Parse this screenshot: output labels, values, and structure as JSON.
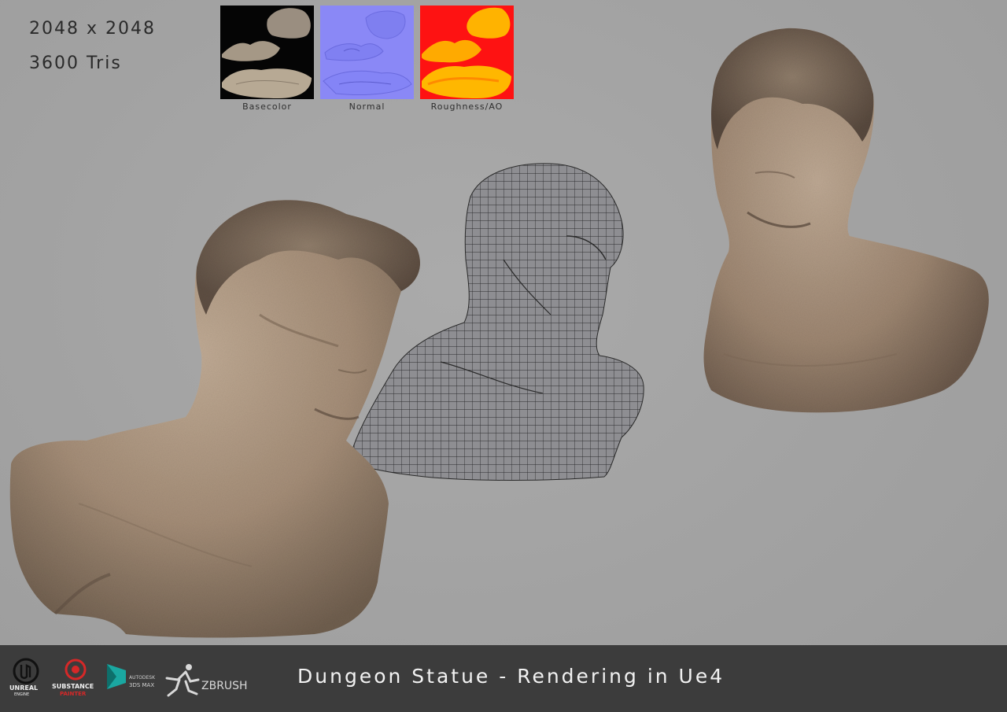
{
  "stats": {
    "resolution": "2048 x 2048",
    "tris": "3600 Tris"
  },
  "textures": [
    {
      "label": "Basecolor"
    },
    {
      "label": "Normal"
    },
    {
      "label": "Roughness/AO"
    }
  ],
  "footer": {
    "title": "Dungeon Statue - Rendering in Ue4",
    "logos": {
      "unreal_main": "UNREAL",
      "unreal_sub": "ENGINE",
      "substance_main": "SUBSTANCE",
      "substance_sub": "PAINTER",
      "max_main": "AUTODESK",
      "max_sub": "3DS MAX",
      "zbrush": "ZBRUSH"
    }
  },
  "colors": {
    "background": "#a3a3a3",
    "footer_bg": "#3c3c3c",
    "footer_text": "#f2f2f2",
    "stat_text": "#2a2a2a",
    "stone": "#a8917a",
    "wire_fill": "#8d8d91",
    "wire_line": "#2b2b2b",
    "roughness_red": "#ff1010",
    "roughness_yellow": "#ffb400",
    "normal_blue": "#8080ff"
  }
}
